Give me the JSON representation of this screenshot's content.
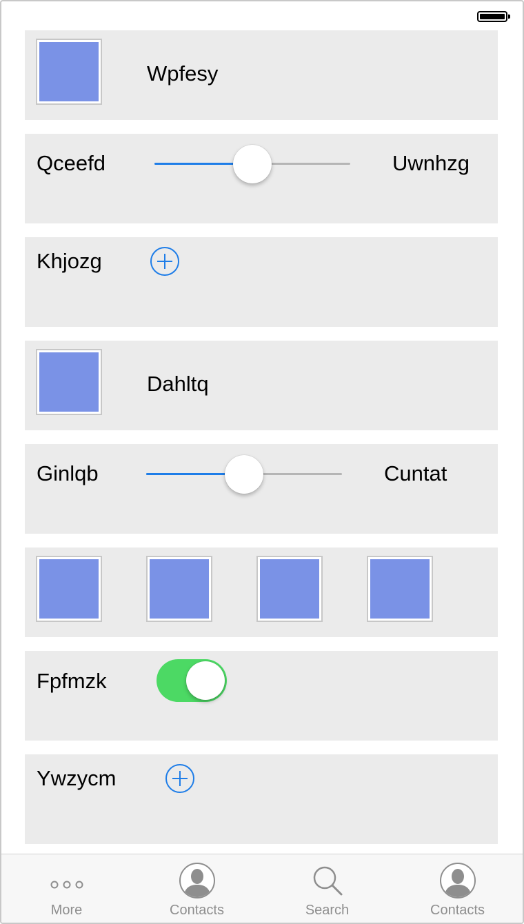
{
  "status_bar": {
    "battery_icon": "battery-icon"
  },
  "rows": [
    {
      "type": "image-label",
      "label": "Wpfesy"
    },
    {
      "type": "slider",
      "left_label": "Qceefd",
      "right_label": "Uwnhzg",
      "value": 0.5
    },
    {
      "type": "add",
      "label": "Khjozg"
    },
    {
      "type": "image-label",
      "label": "Dahltq"
    },
    {
      "type": "slider",
      "left_label": "Ginlqb",
      "right_label": "Cuntat",
      "value": 0.5
    },
    {
      "type": "image-row",
      "count": 4
    },
    {
      "type": "toggle",
      "label": "Fpfmzk",
      "on": true
    },
    {
      "type": "add",
      "label": "Ywzycm"
    }
  ],
  "colors": {
    "accent": "#1e7de8",
    "toggle_on": "#4cd964",
    "image_fill": "#7a92e6",
    "row_bg": "#ebebeb"
  },
  "tabbar": {
    "tabs": [
      {
        "label": "More",
        "icon": "more-icon"
      },
      {
        "label": "Contacts",
        "icon": "contacts-icon"
      },
      {
        "label": "Search",
        "icon": "search-icon"
      },
      {
        "label": "Contacts",
        "icon": "contacts-icon"
      }
    ]
  }
}
